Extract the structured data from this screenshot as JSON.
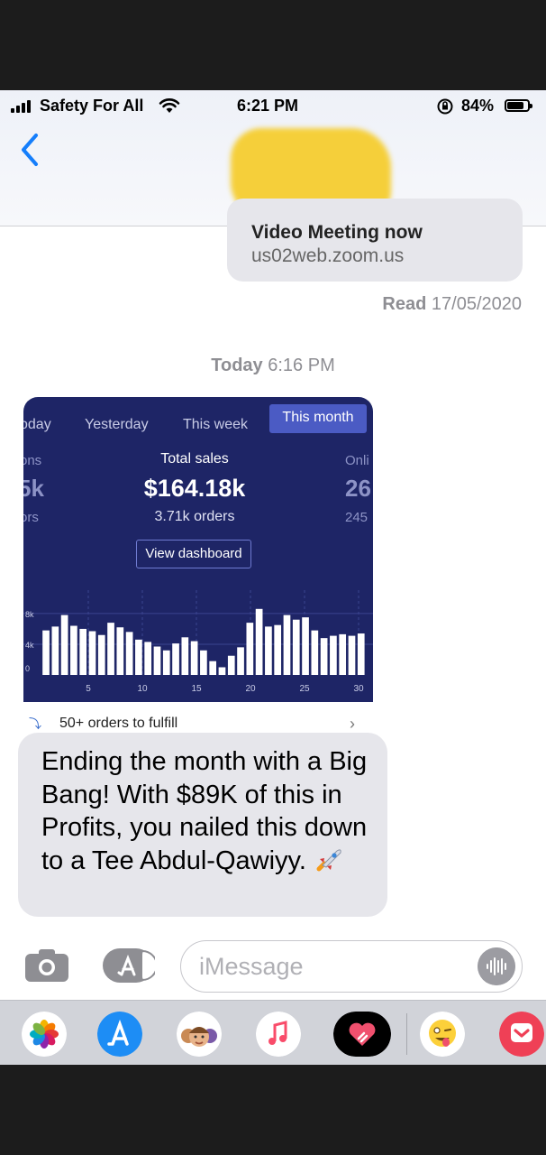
{
  "status_bar": {
    "carrier": "Safety For All",
    "time": "6:21 PM",
    "battery_percent": "84%",
    "battery_level": 0.84
  },
  "conversation": {
    "previous_message": {
      "title": "Video Meeting now",
      "url": "us02web.zoom.us"
    },
    "read_receipt": {
      "label": "Read",
      "date": "17/05/2020"
    },
    "date_header": {
      "day": "Today",
      "time": "6:16 PM"
    },
    "dashboard_card": {
      "tabs": [
        "oday",
        "Yesterday",
        "This week",
        "This month"
      ],
      "active_tab": "This month",
      "left_partial": {
        "label": "ons",
        "value": "5k",
        "sub": "ors"
      },
      "right_partial": {
        "label": "Onli",
        "value": "26",
        "sub": "245"
      },
      "total_sales_label": "Total sales",
      "total_sales_value": "$164.18k",
      "orders": "3.71k orders",
      "view_dashboard": "View dashboard",
      "chart_data": {
        "type": "bar",
        "y_tick_labels": [
          "8k",
          "4k",
          "0"
        ],
        "x_tick_labels": [
          "5",
          "10",
          "15",
          "20",
          "25",
          "30"
        ],
        "ylim": [
          0,
          10000
        ],
        "values": [
          5800,
          6300,
          7800,
          6400,
          6000,
          5700,
          5200,
          6800,
          6200,
          5600,
          4600,
          4300,
          3700,
          3200,
          4100,
          4900,
          4400,
          3200,
          1800,
          1000,
          2500,
          3600,
          6800,
          8600,
          6300,
          6500,
          7800,
          7200,
          7500,
          5800,
          4800,
          5100,
          5300,
          5100,
          5400
        ]
      },
      "fulfill_text": "50+ orders to fulfill"
    },
    "message_text": "Ending the month with a Big Bang! With $89K of this in Profits, you nailed this down to a Tee Abdul-Qawiyy."
  },
  "input_bar": {
    "placeholder": "iMessage"
  },
  "app_drawer": {
    "apps": [
      "photos-app",
      "app-store-app",
      "memoji-app",
      "music-app",
      "digital-touch-app",
      "animoji-app",
      "pocket-app"
    ]
  }
}
